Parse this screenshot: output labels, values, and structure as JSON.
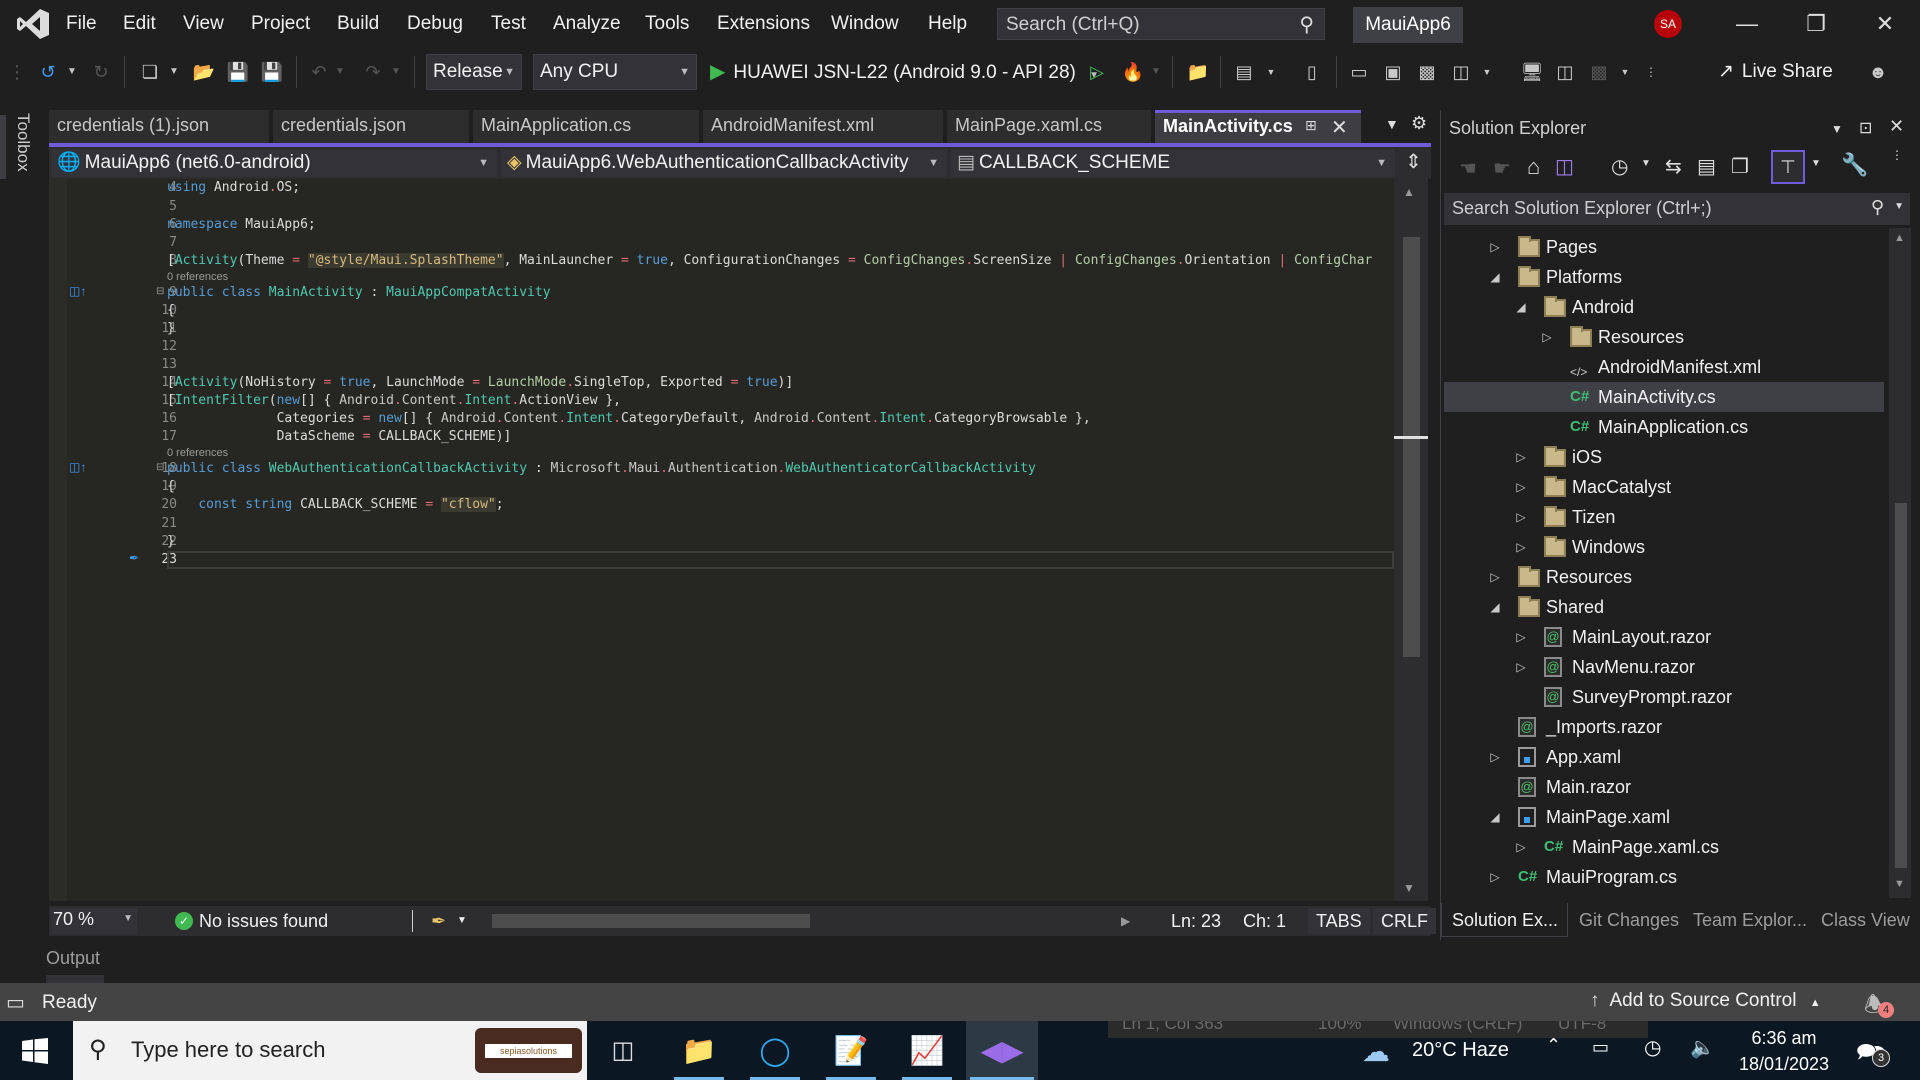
{
  "titlebar": {
    "menu": [
      "File",
      "Edit",
      "View",
      "Project",
      "Build",
      "Debug",
      "Test",
      "Analyze",
      "Tools",
      "Extensions",
      "Window",
      "Help"
    ],
    "search_placeholder": "Search (Ctrl+Q)",
    "solution_name": "MauiApp6",
    "user_initials": "SA",
    "accent": "#6f5cd8"
  },
  "toolbar": {
    "configuration": "Release",
    "platform": "Any CPU",
    "run_target": "HUAWEI JSN-L22 (Android 9.0 - API 28)",
    "live_share": "Live Share"
  },
  "toolbox_label": "Toolbox",
  "tabs": [
    {
      "label": "credentials (1).json",
      "active": false
    },
    {
      "label": "credentials.json",
      "active": false
    },
    {
      "label": "MainApplication.cs",
      "active": false
    },
    {
      "label": "AndroidManifest.xml",
      "active": false
    },
    {
      "label": "MainPage.xaml.cs",
      "active": false
    },
    {
      "label": "MainActivity.cs",
      "active": true
    }
  ],
  "navbar": {
    "project": "MauiApp6 (net6.0-android)",
    "type": "MauiApp6.WebAuthenticationCallbackActivity",
    "member": "CALLBACK_SCHEME"
  },
  "editor": {
    "line_numbers": [
      "4",
      "5",
      "6",
      "7",
      "8",
      "9",
      "10",
      "11",
      "12",
      "13",
      "14",
      "15",
      "16",
      "17",
      "18",
      "19",
      "20",
      "21",
      "22",
      "23"
    ],
    "codelens": "0 references",
    "lines": {
      "l4": "using Android.OS;",
      "l6": "namespace MauiApp6;",
      "l8": "[Activity(Theme = \"@style/Maui.SplashTheme\", MainLauncher = true, ConfigurationChanges = ConfigChanges.ScreenSize | ConfigChanges.Orientation | ConfigChar",
      "l9": "public class MainActivity : MauiAppCompatActivity",
      "l10": "{",
      "l11": "}",
      "l14": "[Activity(NoHistory = true, LaunchMode = LaunchMode.SingleTop, Exported = true)]",
      "l15": "[IntentFilter(new[] { Android.Content.Intent.ActionView },",
      "l16": "              Categories = new[] { Android.Content.Intent.CategoryDefault, Android.Content.Intent.CategoryBrowsable },",
      "l17": "              DataScheme = CALLBACK_SCHEME)]",
      "l18": "public class WebAuthenticationCallbackActivity : Microsoft.Maui.Authentication.WebAuthenticatorCallbackActivity",
      "l19": "{",
      "l20": "    const string CALLBACK_SCHEME = \"cflow\";",
      "l22": "}"
    }
  },
  "editor_status": {
    "zoom": "70 %",
    "issues": "No issues found",
    "line": "Ln: 23",
    "col": "Ch: 1",
    "indent": "TABS",
    "eol": "CRLF"
  },
  "output_label": "Output",
  "statusbar": {
    "text": "Ready",
    "source_control": "Add to Source Control",
    "notifications": "4"
  },
  "ghost_notepad": {
    "position": "Ln 1, Col 363",
    "zoom": "100%",
    "eol": "Windows (CRLF)",
    "encoding": "UTF-8"
  },
  "solution_explorer": {
    "title": "Solution Explorer",
    "search_placeholder": "Search Solution Explorer (Ctrl+;)",
    "tree": [
      {
        "label": "Pages",
        "icon": "folder",
        "depth": 1,
        "expander": "collapsed"
      },
      {
        "label": "Platforms",
        "icon": "folder",
        "depth": 1,
        "expander": "expanded"
      },
      {
        "label": "Android",
        "icon": "folder",
        "depth": 2,
        "expander": "expanded"
      },
      {
        "label": "Resources",
        "icon": "folder",
        "depth": 3,
        "expander": "collapsed"
      },
      {
        "label": "AndroidManifest.xml",
        "icon": "xml",
        "depth": 3,
        "expander": "none"
      },
      {
        "label": "MainActivity.cs",
        "icon": "csharp",
        "depth": 3,
        "expander": "none",
        "selected": true
      },
      {
        "label": "MainApplication.cs",
        "icon": "csharp",
        "depth": 3,
        "expander": "none"
      },
      {
        "label": "iOS",
        "icon": "folder",
        "depth": 2,
        "expander": "collapsed"
      },
      {
        "label": "MacCatalyst",
        "icon": "folder",
        "depth": 2,
        "expander": "collapsed"
      },
      {
        "label": "Tizen",
        "icon": "folder",
        "depth": 2,
        "expander": "collapsed"
      },
      {
        "label": "Windows",
        "icon": "folder",
        "depth": 2,
        "expander": "collapsed"
      },
      {
        "label": "Resources",
        "icon": "folder",
        "depth": 1,
        "expander": "collapsed"
      },
      {
        "label": "Shared",
        "icon": "folder",
        "depth": 1,
        "expander": "expanded"
      },
      {
        "label": "MainLayout.razor",
        "icon": "razor",
        "depth": 2,
        "expander": "collapsed"
      },
      {
        "label": "NavMenu.razor",
        "icon": "razor",
        "depth": 2,
        "expander": "collapsed"
      },
      {
        "label": "SurveyPrompt.razor",
        "icon": "razor",
        "depth": 2,
        "expander": "none"
      },
      {
        "label": "_Imports.razor",
        "icon": "razor",
        "depth": 1,
        "expander": "none"
      },
      {
        "label": "App.xaml",
        "icon": "xaml",
        "depth": 1,
        "expander": "collapsed"
      },
      {
        "label": "Main.razor",
        "icon": "razor",
        "depth": 1,
        "expander": "none"
      },
      {
        "label": "MainPage.xaml",
        "icon": "xaml",
        "depth": 1,
        "expander": "expanded"
      },
      {
        "label": "MainPage.xaml.cs",
        "icon": "csharp",
        "depth": 2,
        "expander": "collapsed"
      },
      {
        "label": "MauiProgram.cs",
        "icon": "csharp",
        "depth": 1,
        "expander": "collapsed"
      }
    ],
    "bottom_tabs": [
      "Solution Ex...",
      "Git Changes",
      "Team Explor...",
      "Class View"
    ]
  },
  "taskbar": {
    "search_placeholder": "Type here to search",
    "promo_text": "sepiasolutions",
    "weather": "20°C  Haze",
    "time": "6:36 am",
    "date": "18/01/2023",
    "action_center_count": "3"
  }
}
